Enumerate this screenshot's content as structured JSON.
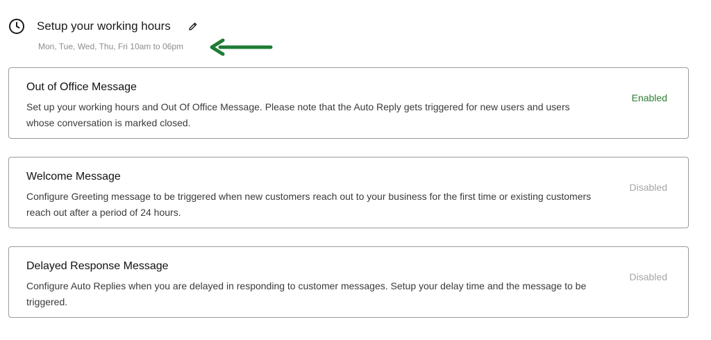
{
  "working_hours": {
    "title": "Setup your working hours",
    "schedule": "Mon, Tue, Wed, Thu, Fri 10am to 06pm",
    "icon": "clock-icon",
    "edit_icon": "pencil-icon"
  },
  "annotation": {
    "arrow_color": "#1e7b34"
  },
  "colors": {
    "enabled": "#2e7d32",
    "disabled": "#a6a6a6",
    "card_border": "#9a9a9a"
  },
  "cards": [
    {
      "title": "Out of Office Message",
      "description": "Set up your working hours and Out Of Office Message. Please note that the Auto Reply gets triggered for new users and users whose conversation is marked closed.",
      "status": "Enabled"
    },
    {
      "title": "Welcome Message",
      "description": "Configure Greeting message to be triggered when new customers reach out to your business for the first time or existing customers reach out after a period of 24 hours.",
      "status": "Disabled"
    },
    {
      "title": "Delayed Response Message",
      "description": "Configure Auto Replies when you are delayed in responding to customer messages. Setup your delay time and the message to be triggered.",
      "status": "Disabled"
    }
  ]
}
